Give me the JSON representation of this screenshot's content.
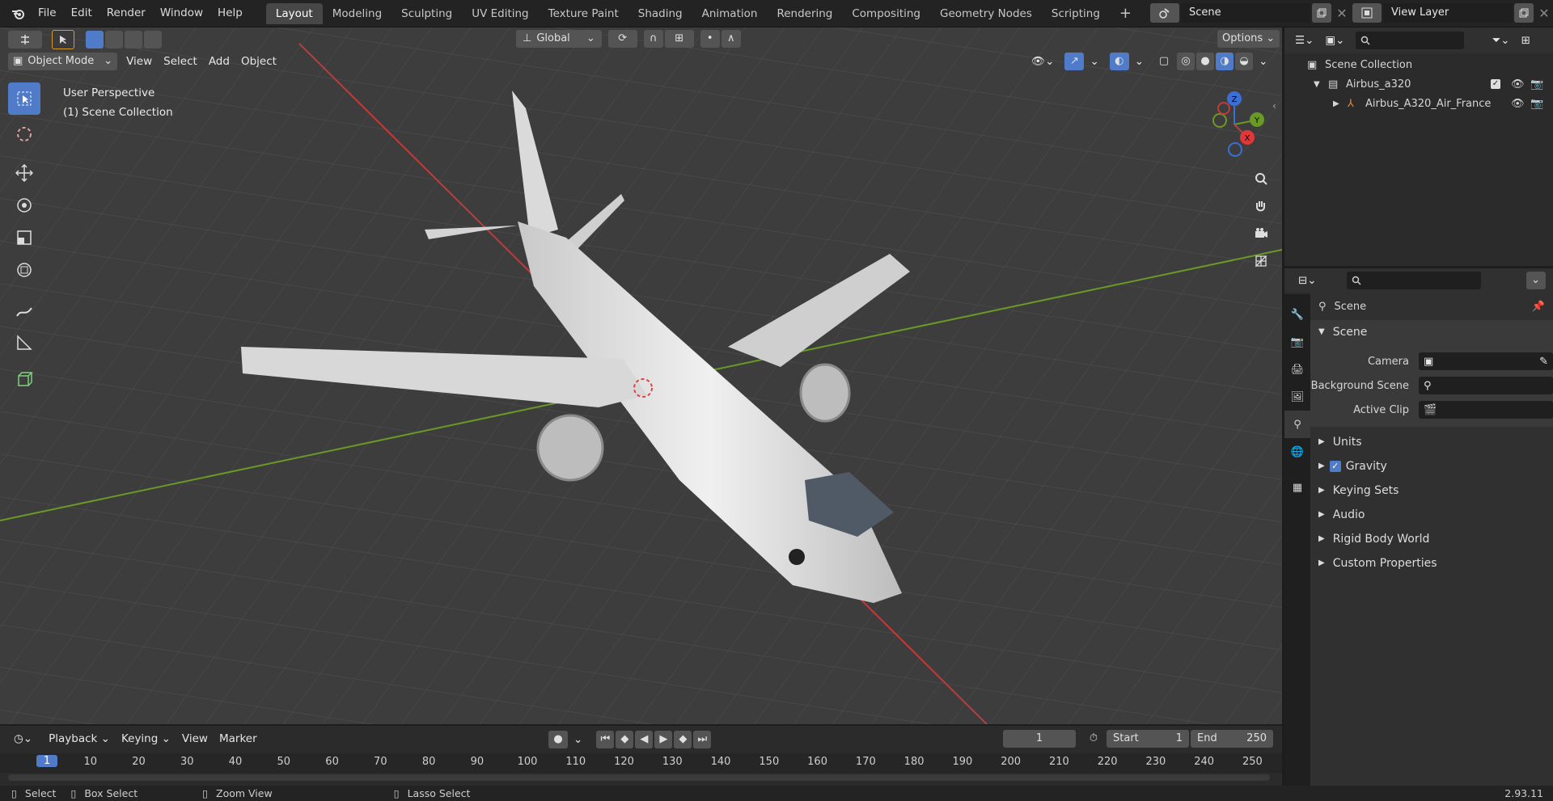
{
  "menu": [
    "File",
    "Edit",
    "Render",
    "Window",
    "Help"
  ],
  "workspaces": [
    "Layout",
    "Modeling",
    "Sculpting",
    "UV Editing",
    "Texture Paint",
    "Shading",
    "Animation",
    "Rendering",
    "Compositing",
    "Geometry Nodes",
    "Scripting"
  ],
  "active_workspace": "Layout",
  "scene_selector": "Scene",
  "view_layer_selector": "View Layer",
  "viewport": {
    "transform_orientation": "Global",
    "options_label": "Options",
    "mode": "Object Mode",
    "header_menus": [
      "View",
      "Select",
      "Add",
      "Object"
    ],
    "perspective_label": "User Perspective",
    "collection_label": "(1) Scene Collection",
    "gizmo": {
      "x": "X",
      "y": "Y",
      "z": "Z"
    }
  },
  "outliner": {
    "root": "Scene Collection",
    "items": [
      {
        "name": "Airbus_a320",
        "type": "collection"
      },
      {
        "name": "Airbus_A320_Air_France",
        "type": "object"
      }
    ]
  },
  "properties": {
    "context": "Scene",
    "panel_title": "Scene",
    "fields": [
      {
        "label": "Camera",
        "value": ""
      },
      {
        "label": "Background Scene",
        "value": ""
      },
      {
        "label": "Active Clip",
        "value": ""
      }
    ],
    "subpanels": [
      "Units",
      "Gravity",
      "Keying Sets",
      "Audio",
      "Rigid Body World",
      "Custom Properties"
    ],
    "gravity_checked": true
  },
  "timeline": {
    "menus": [
      "Playback",
      "Keying",
      "View",
      "Marker"
    ],
    "current_frame": "1",
    "start_label": "Start",
    "start_value": "1",
    "end_label": "End",
    "end_value": "250",
    "ticks": [
      "1",
      "10",
      "20",
      "30",
      "40",
      "50",
      "60",
      "70",
      "80",
      "90",
      "100",
      "110",
      "120",
      "130",
      "140",
      "150",
      "160",
      "170",
      "180",
      "190",
      "200",
      "210",
      "220",
      "230",
      "240",
      "250"
    ]
  },
  "statusbar": {
    "select": "Select",
    "box_select": "Box Select",
    "zoom_view": "Zoom View",
    "lasso_select": "Lasso Select",
    "version": "2.93.11"
  },
  "colors": {
    "accent": "#4f7bc9",
    "x_axis": "#c23a3a",
    "y_axis": "#6a9a25",
    "z_axis": "#3b6fd6"
  }
}
